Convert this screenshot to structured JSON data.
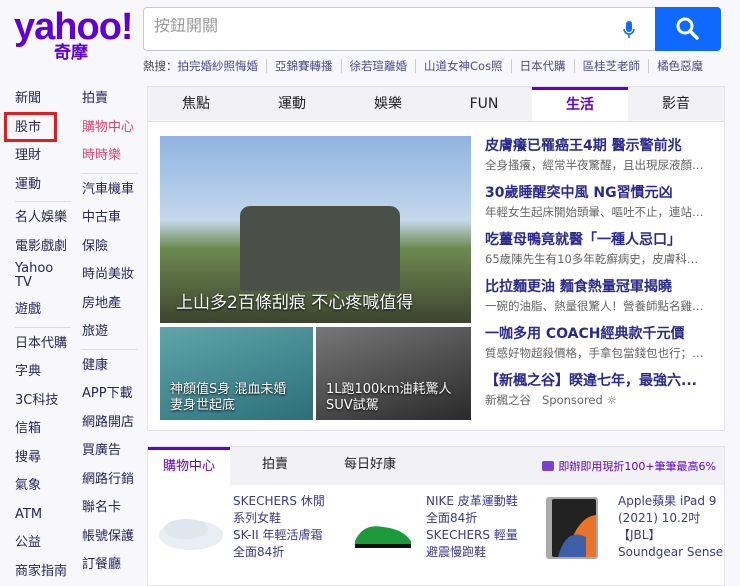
{
  "logo": {
    "brand": "yahoo!",
    "sub": "奇摩"
  },
  "search": {
    "placeholder": "按鈕開關"
  },
  "hot": {
    "label": "熱搜：",
    "items": [
      "拍完婚紗照悔婚",
      "亞錦賽轉播",
      "徐若瑄離婚",
      "山道女神Cos照",
      "日本代購",
      "區桂芝老師",
      "橘色惡魔"
    ]
  },
  "nav_left": [
    "新聞",
    "股市",
    "理財",
    "運動",
    "名人娛樂",
    "電影戲劇",
    "Yahoo TV",
    "遊戲",
    "日本代購",
    "字典",
    "3C科技",
    "信箱",
    "搜尋",
    "氣象",
    "ATM",
    "公益",
    "商家指南"
  ],
  "nav_right": [
    "拍賣",
    "購物中心",
    "時時樂",
    "汽車機車",
    "中古車",
    "保險",
    "時尚美妝",
    "房地產",
    "旅遊",
    "健康",
    "APP下載",
    "網路開店",
    "買廣告",
    "網路行銷",
    "聯名卡",
    "帳號保護",
    "訂餐廳"
  ],
  "tabs": [
    "焦點",
    "運動",
    "娛樂",
    "FUN",
    "生活",
    "影音"
  ],
  "active_tab": "生活",
  "features": {
    "main": "上山多2百條刮痕 不心疼喊值得",
    "left": [
      "神顏值S身 混血未婚",
      "妻身世起底"
    ],
    "right": [
      "1L跑100km油耗驚人",
      "SUV試駕"
    ]
  },
  "news": [
    {
      "title": "皮膚癢已罹癌王4期 醫示警前兆",
      "desc": "全身搔癢，經常半夜驚醒，且出現尿液顏…"
    },
    {
      "title": "30歲睡醒突中風 NG習慣元凶",
      "desc": "年輕女生起床開始頭暈、嘔吐不止，連站…"
    },
    {
      "title": "吃薑母鴨竟就醫「一種人忌口」",
      "desc": "65歲陳先生有10多年乾癬病史，皮膚科…"
    },
    {
      "title": "比拉麵更油 麵食熱量冠軍揭曉",
      "desc": "一碗的油脂、熱量很驚人！營養師點名雞…"
    },
    {
      "title": "一咖多用 COACH經典款千元價",
      "desc": "質感好物超殺價格，手拿包當錢包也行；…"
    },
    {
      "title": "【新楓之谷】睽違七年，最強六...",
      "desc": "新楓之谷",
      "sponsored": "Sponsored"
    }
  ],
  "shop": {
    "tabs": [
      "購物中心",
      "拍賣",
      "每日好康"
    ],
    "promo": "即辦即用現折100+筆筆最高6%",
    "products": [
      [
        "SKECHERS 休閒",
        "系列女鞋",
        "SK-II 年輕活膚霜",
        "全面84折"
      ],
      [
        "NIKE 皮革運動鞋",
        "全面84折",
        "SKECHERS 輕量",
        "避震慢跑鞋"
      ],
      [
        "Apple蘋果 iPad 9",
        "(2021) 10.2吋",
        "【JBL】",
        "Soundgear Sense"
      ]
    ]
  },
  "colors": {
    "brand": "#6001d2",
    "search_button": "#0f69ff",
    "highlight_box": "#e21d1d"
  }
}
